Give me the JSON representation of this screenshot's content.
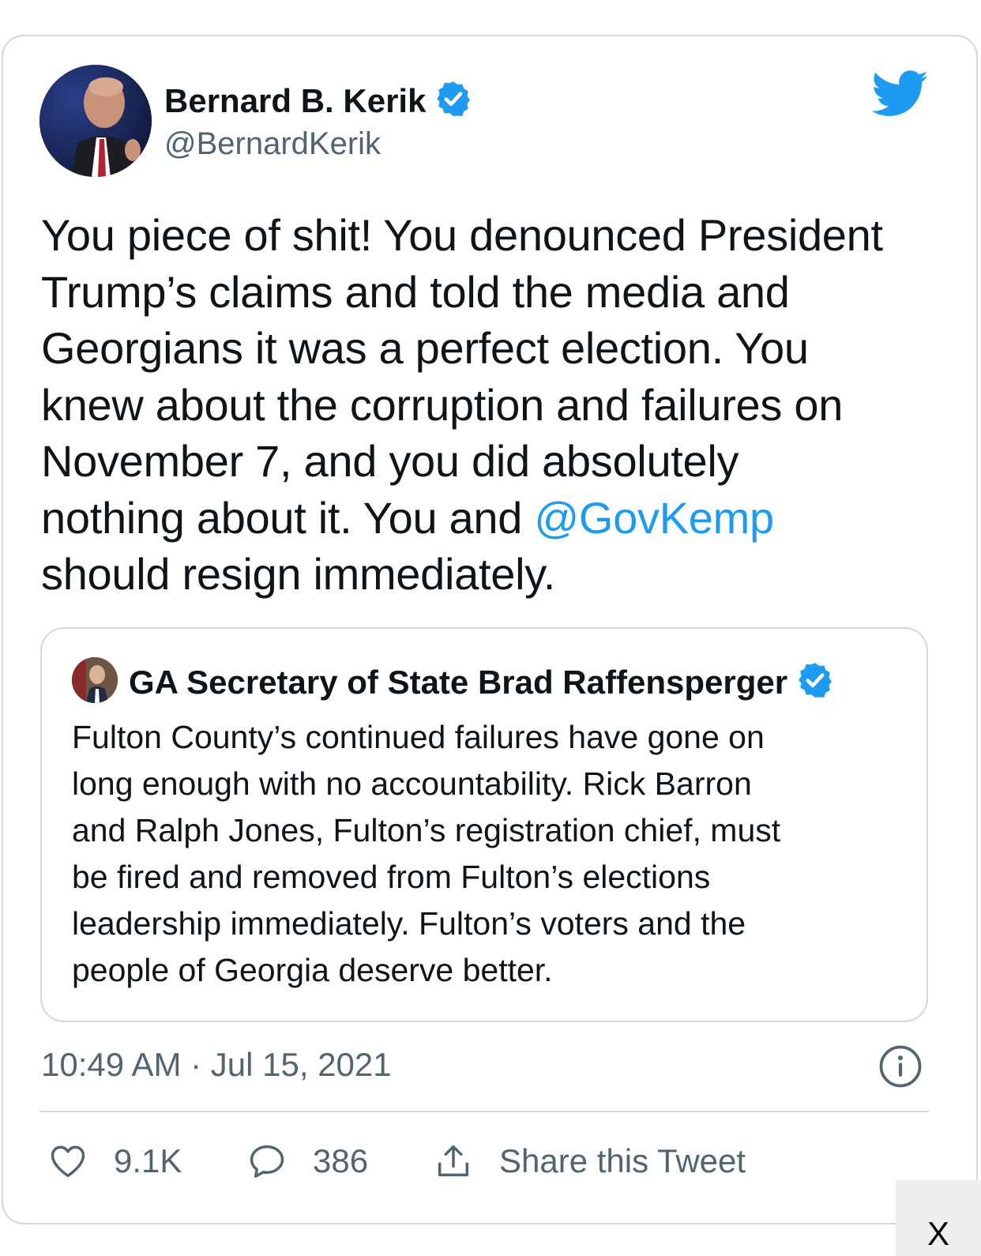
{
  "tweet": {
    "author_name": "Bernard B. Kerik",
    "author_handle": "@BernardKerik",
    "text_lines": [
      "You piece of shit! You denounced President",
      "Trump’s claims and told the media and",
      "Georgians it was a perfect election. You",
      "knew about the corruption and failures on",
      "November 7, and you did absolutely",
      "nothing about it. You and "
    ],
    "mention": "@GovKemp",
    "text_last": "should resign immediately.",
    "timestamp": "10:49 AM · Jul 15, 2021"
  },
  "quote": {
    "author_name": "GA Secretary of State Brad Raffensperger",
    "text_lines": [
      "Fulton County’s continued failures have gone on",
      "long enough with no accountability. Rick Barron",
      "and Ralph Jones, Fulton’s registration chief, must",
      "be fired and removed from Fulton’s elections",
      "leadership immediately. Fulton’s voters and the",
      "people of Georgia deserve better."
    ]
  },
  "actions": {
    "like_count": "9.1K",
    "reply_count": "386",
    "share_label": "Share this Tweet"
  },
  "overlay": {
    "close_label": "X"
  },
  "colors": {
    "accent": "#1d9bf0",
    "text": "#0f1419",
    "secondary": "#536471",
    "border": "#cfd9de"
  },
  "icons": [
    "verified-badge-icon",
    "twitter-bird-icon",
    "info-icon",
    "heart-icon",
    "reply-icon",
    "share-icon"
  ]
}
